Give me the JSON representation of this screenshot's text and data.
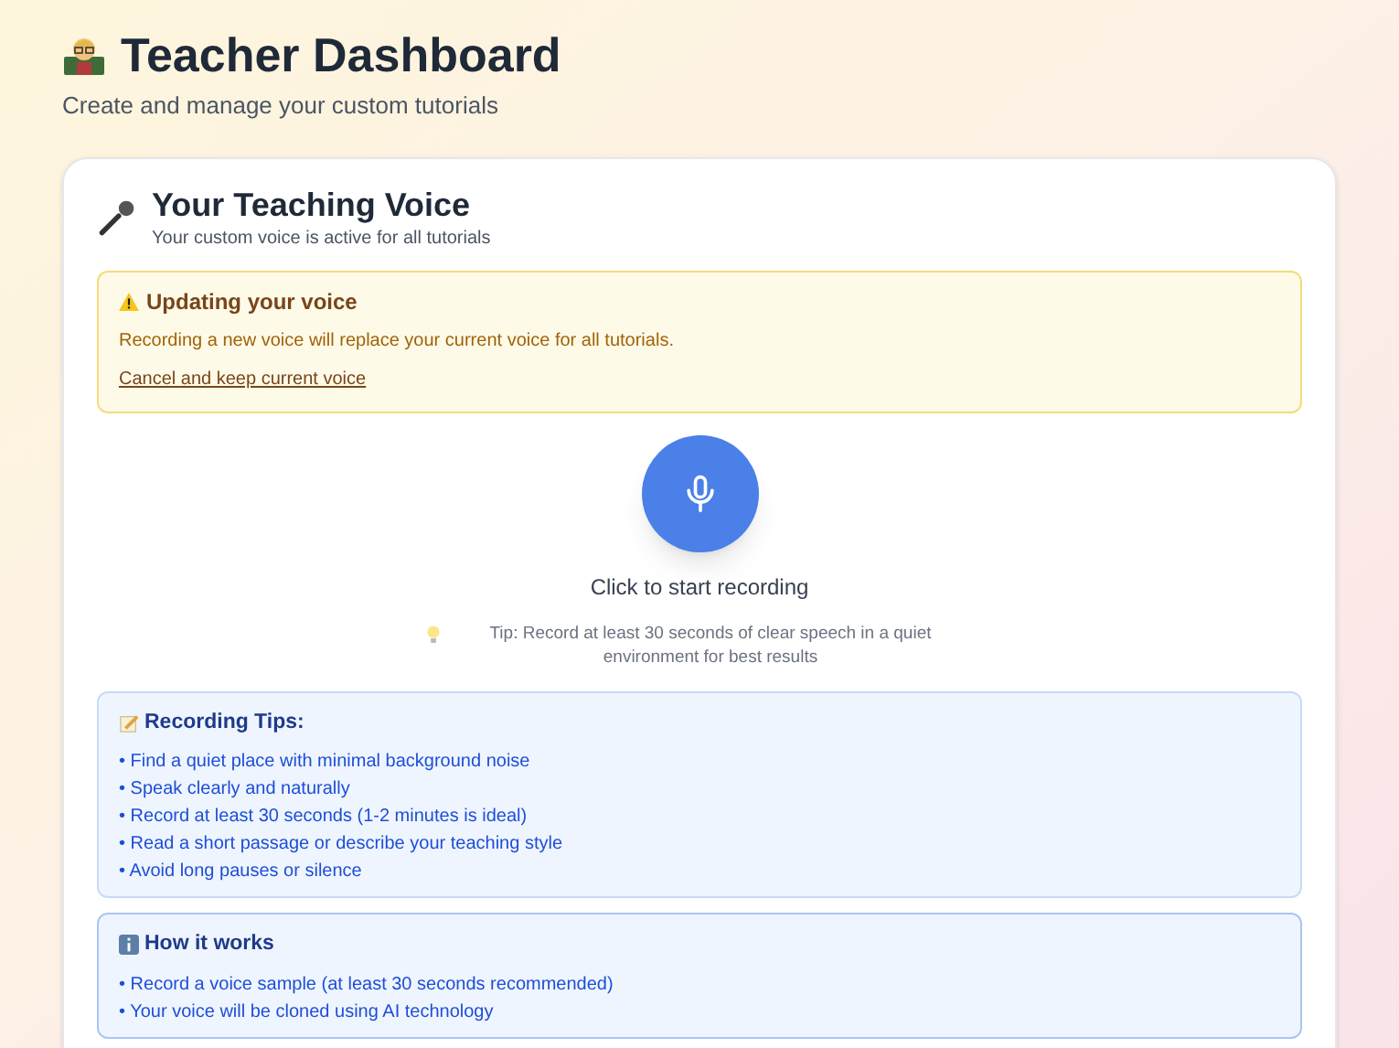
{
  "header": {
    "title": "Teacher Dashboard",
    "subtitle": "Create and manage your custom tutorials"
  },
  "voice_card": {
    "title": "Your Teaching Voice",
    "subtitle": "Your custom voice is active for all tutorials",
    "warning": {
      "title": "Updating your voice",
      "message": "Recording a new voice will replace your current voice for all tutorials.",
      "link": "Cancel and keep current voice"
    },
    "record": {
      "label": "Click to start recording",
      "tip": "Tip: Record at least 30 seconds of clear speech in a quiet environment for best results"
    },
    "info_boxes": [
      {
        "kind": "tips",
        "title": "Recording Tips:",
        "items": [
          "• Find a quiet place with minimal background noise",
          "• Speak clearly and naturally",
          "• Record at least 30 seconds (1-2 minutes is ideal)",
          "• Read a short passage or describe your teaching style",
          "• Avoid long pauses or silence"
        ]
      },
      {
        "kind": "info",
        "title": "How it works",
        "items": [
          "• Record a voice sample (at least 30 seconds recommended)",
          "• Your voice will be cloned using AI technology"
        ]
      }
    ]
  }
}
